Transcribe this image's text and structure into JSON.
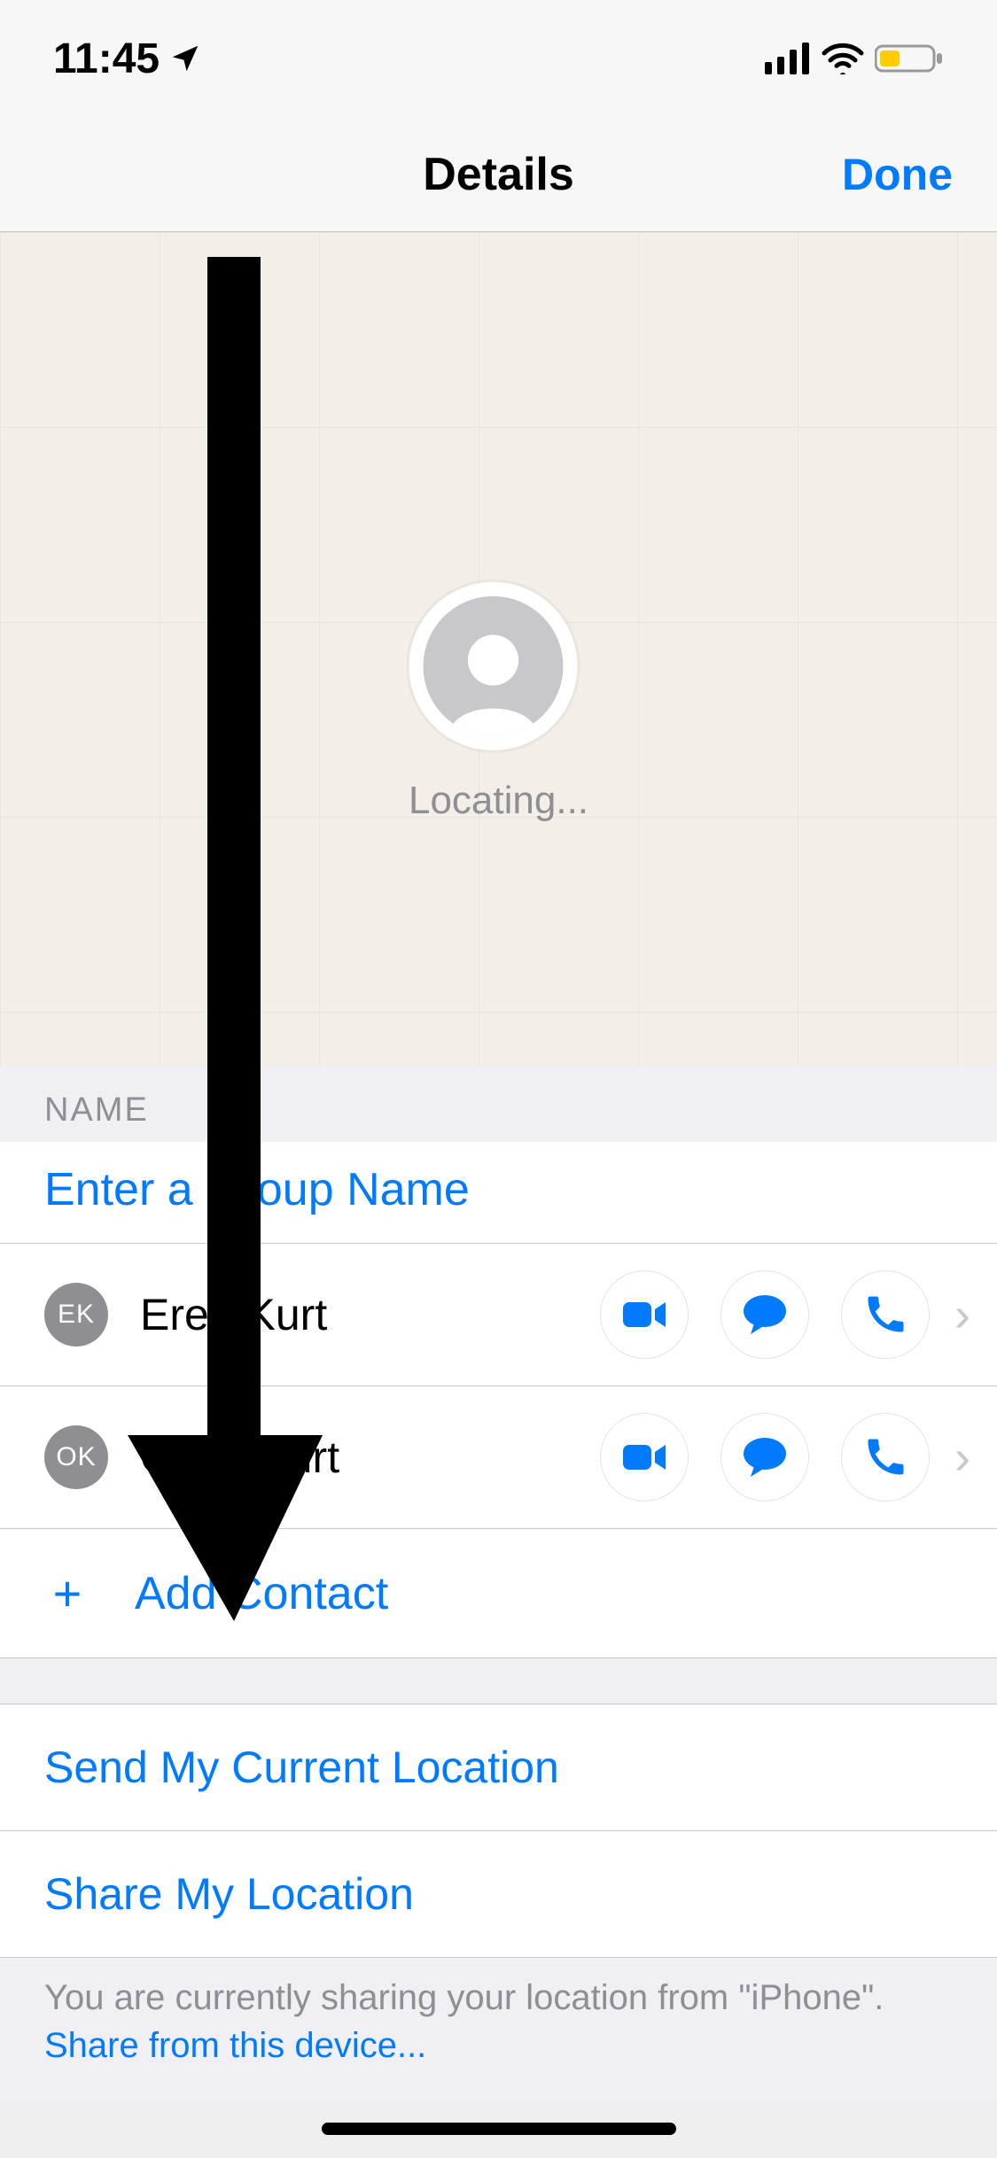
{
  "status": {
    "time": "11:45"
  },
  "nav": {
    "title": "Details",
    "done": "Done"
  },
  "map": {
    "status": "Locating..."
  },
  "name_section_header": "NAME",
  "group_name_placeholder": "Enter a Group Name",
  "contacts": [
    {
      "initials": "EK",
      "name": "Eren Kurt"
    },
    {
      "initials": "OK",
      "name": "Ozge Kurt"
    }
  ],
  "add_contact": "Add Contact",
  "send_location": "Send My Current Location",
  "share_location": "Share My Location",
  "footer_text": "You are currently sharing your location from \"iPhone\". ",
  "footer_link": "Share from this device..."
}
